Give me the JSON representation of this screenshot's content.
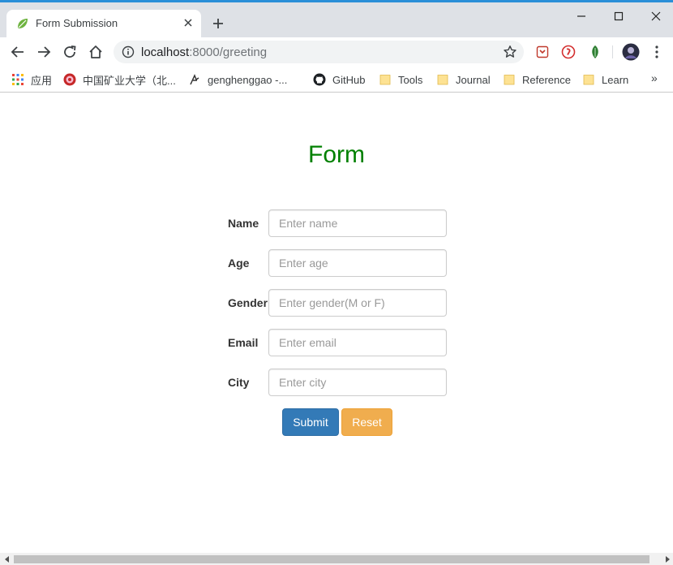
{
  "browser": {
    "tab": {
      "title": "Form Submission"
    },
    "address": {
      "host": "localhost",
      "port_path": ":8000/greeting"
    },
    "bookmarks": [
      {
        "label": "应用",
        "icon": "apps-grid-icon"
      },
      {
        "label": "中国矿业大学（北...",
        "icon": "university-icon"
      },
      {
        "label": "genghenggao -...",
        "icon": "profile-icon"
      },
      {
        "label": "GitHub",
        "icon": "github-icon"
      },
      {
        "label": "Tools",
        "icon": "folder-icon"
      },
      {
        "label": "Journal",
        "icon": "folder-icon"
      },
      {
        "label": "Reference",
        "icon": "folder-icon"
      },
      {
        "label": "Learn",
        "icon": "folder-icon"
      }
    ],
    "bookmarks_more": "»"
  },
  "page": {
    "title": "Form",
    "fields": [
      {
        "label": "Name",
        "placeholder": "Enter name"
      },
      {
        "label": "Age",
        "placeholder": "Enter age"
      },
      {
        "label": "Gender",
        "placeholder": "Enter gender(M or F)"
      },
      {
        "label": "Email",
        "placeholder": "Enter email"
      },
      {
        "label": "City",
        "placeholder": "Enter city"
      }
    ],
    "submit_label": "Submit",
    "reset_label": "Reset"
  },
  "colors": {
    "title": "#008000",
    "submit": "#337ab7",
    "reset": "#f0ad4e"
  }
}
